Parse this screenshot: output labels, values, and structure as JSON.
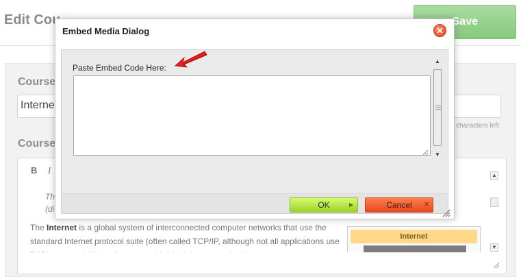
{
  "page": {
    "title": "Edit Cou",
    "save_label": "Save",
    "course_name_label": "Course",
    "course_name_value": "Internet",
    "chars_left_text": "characters left",
    "course_desc_label": "Course"
  },
  "editor": {
    "toolbar": {
      "bold": "B",
      "italic": "I"
    },
    "italic_note_lines": [
      "Th",
      "(di"
    ],
    "para_parts": {
      "before": "The ",
      "bold": "Internet",
      "after": " is a global system of interconnected computer networks that use the standard Internet protocol suite (often called TCP/IP, although not all applications use TCP) to serve billions of users worldwide. It is a network of"
    },
    "infobox_title": "Internet"
  },
  "dialog": {
    "title": "Embed Media Dialog",
    "embed_label": "Paste Embed Code Here:",
    "embed_value": "",
    "ok_label": "OK",
    "cancel_label": "Cancel"
  },
  "icons": {
    "close": "close-icon",
    "bold": "bold-icon",
    "italic": "italic-icon",
    "scroll_up": "scroll-up-icon",
    "scroll_down": "scroll-down-icon",
    "resize": "resize-grip-icon",
    "annotation_arrow": "red-arrow-icon"
  },
  "colors": {
    "save_button": "#8fce84",
    "ok_button": "#b8e64a",
    "cancel_button": "#f05a2c",
    "close_button": "#e84a24",
    "arrow": "#e01010"
  }
}
